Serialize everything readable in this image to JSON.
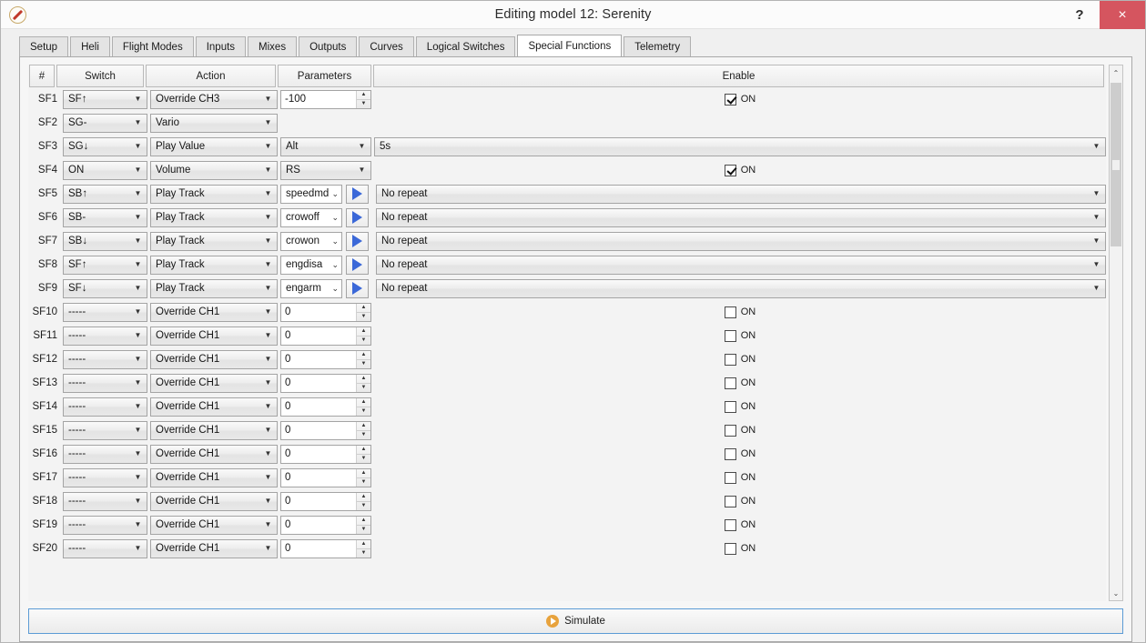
{
  "window": {
    "title": "Editing model 12: Serenity",
    "help_label": "?",
    "close_label": "×"
  },
  "tabs": [
    {
      "label": "Setup",
      "active": false
    },
    {
      "label": "Heli",
      "active": false
    },
    {
      "label": "Flight Modes",
      "active": false
    },
    {
      "label": "Inputs",
      "active": false
    },
    {
      "label": "Mixes",
      "active": false
    },
    {
      "label": "Outputs",
      "active": false
    },
    {
      "label": "Curves",
      "active": false
    },
    {
      "label": "Logical Switches",
      "active": false
    },
    {
      "label": "Special Functions",
      "active": true
    },
    {
      "label": "Telemetry",
      "active": false
    }
  ],
  "table": {
    "headers": {
      "num": "#",
      "switch": "Switch",
      "action": "Action",
      "parameters": "Parameters",
      "enable": "Enable"
    },
    "rows": [
      {
        "id": "SF1",
        "switch": "SF↑",
        "action": "Override CH3",
        "param_type": "spin",
        "param": "-100",
        "enable_type": "check",
        "enable": "ON",
        "checked": true
      },
      {
        "id": "SF2",
        "switch": "SG-",
        "action": "Vario",
        "param_type": "none",
        "param": "",
        "enable_type": "none",
        "enable": "",
        "checked": false
      },
      {
        "id": "SF3",
        "switch": "SG↓",
        "action": "Play Value",
        "param_type": "combo",
        "param": "Alt",
        "enable_type": "combo",
        "enable": "5s",
        "checked": false
      },
      {
        "id": "SF4",
        "switch": "ON",
        "action": "Volume",
        "param_type": "combo",
        "param": "RS",
        "enable_type": "check",
        "enable": "ON",
        "checked": true
      },
      {
        "id": "SF5",
        "switch": "SB↑",
        "action": "Play Track",
        "param_type": "track",
        "param": "speedmd",
        "enable_type": "combo",
        "enable": "No repeat",
        "checked": false
      },
      {
        "id": "SF6",
        "switch": "SB-",
        "action": "Play Track",
        "param_type": "track",
        "param": "crowoff",
        "enable_type": "combo",
        "enable": "No repeat",
        "checked": false
      },
      {
        "id": "SF7",
        "switch": "SB↓",
        "action": "Play Track",
        "param_type": "track",
        "param": "crowon",
        "enable_type": "combo",
        "enable": "No repeat",
        "checked": false
      },
      {
        "id": "SF8",
        "switch": "SF↑",
        "action": "Play Track",
        "param_type": "track",
        "param": "engdisa",
        "enable_type": "combo",
        "enable": "No repeat",
        "checked": false
      },
      {
        "id": "SF9",
        "switch": "SF↓",
        "action": "Play Track",
        "param_type": "track",
        "param": "engarm",
        "enable_type": "combo",
        "enable": "No repeat",
        "checked": false
      },
      {
        "id": "SF10",
        "switch": "-----",
        "action": "Override CH1",
        "param_type": "spin",
        "param": "0",
        "enable_type": "check",
        "enable": "ON",
        "checked": false
      },
      {
        "id": "SF11",
        "switch": "-----",
        "action": "Override CH1",
        "param_type": "spin",
        "param": "0",
        "enable_type": "check",
        "enable": "ON",
        "checked": false
      },
      {
        "id": "SF12",
        "switch": "-----",
        "action": "Override CH1",
        "param_type": "spin",
        "param": "0",
        "enable_type": "check",
        "enable": "ON",
        "checked": false
      },
      {
        "id": "SF13",
        "switch": "-----",
        "action": "Override CH1",
        "param_type": "spin",
        "param": "0",
        "enable_type": "check",
        "enable": "ON",
        "checked": false
      },
      {
        "id": "SF14",
        "switch": "-----",
        "action": "Override CH1",
        "param_type": "spin",
        "param": "0",
        "enable_type": "check",
        "enable": "ON",
        "checked": false
      },
      {
        "id": "SF15",
        "switch": "-----",
        "action": "Override CH1",
        "param_type": "spin",
        "param": "0",
        "enable_type": "check",
        "enable": "ON",
        "checked": false
      },
      {
        "id": "SF16",
        "switch": "-----",
        "action": "Override CH1",
        "param_type": "spin",
        "param": "0",
        "enable_type": "check",
        "enable": "ON",
        "checked": false
      },
      {
        "id": "SF17",
        "switch": "-----",
        "action": "Override CH1",
        "param_type": "spin",
        "param": "0",
        "enable_type": "check",
        "enable": "ON",
        "checked": false
      },
      {
        "id": "SF18",
        "switch": "-----",
        "action": "Override CH1",
        "param_type": "spin",
        "param": "0",
        "enable_type": "check",
        "enable": "ON",
        "checked": false
      },
      {
        "id": "SF19",
        "switch": "-----",
        "action": "Override CH1",
        "param_type": "spin",
        "param": "0",
        "enable_type": "check",
        "enable": "ON",
        "checked": false
      },
      {
        "id": "SF20",
        "switch": "-----",
        "action": "Override CH1",
        "param_type": "spin",
        "param": "0",
        "enable_type": "check",
        "enable": "ON",
        "checked": false
      }
    ]
  },
  "scrollbar": {
    "up_arrow": "⌃",
    "down_arrow": "⌄"
  },
  "footer": {
    "simulate_label": "Simulate"
  },
  "icons": {
    "combo_arrow": "▼",
    "chevron_down": "⌄",
    "spin_up": "▲",
    "spin_down": "▼"
  },
  "colors": {
    "accent_blue": "#3b68d8",
    "close_red": "#d5555f",
    "sim_orange": "#e8a33d",
    "focus_border": "#5b9bd5"
  }
}
